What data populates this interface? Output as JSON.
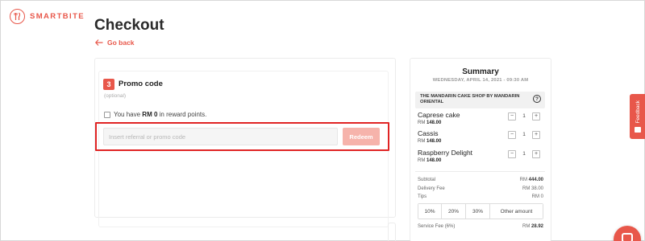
{
  "brand": {
    "name": "SMARTBITE",
    "color": "#e8574a",
    "logo_icon": "fork-knife-icon"
  },
  "page": {
    "title": "Checkout",
    "back_label": "Go back"
  },
  "promo": {
    "step": "3",
    "title": "Promo code",
    "optional": "(optional)",
    "reward_prefix": "You have ",
    "reward_amount": "RM 0",
    "reward_suffix": " in reward points.",
    "reward_checked": false,
    "input_placeholder": "Insert referral or promo code",
    "input_value": "",
    "redeem_label": "Redeem"
  },
  "summary": {
    "title": "Summary",
    "datetime": "WEDNESDAY, APRIL 14, 2021 - 09:30 AM",
    "shop": "THE MANDARIN CAKE SHOP BY MANDARIN ORIENTAL",
    "help": "?",
    "items": [
      {
        "name": "Caprese cake",
        "currency": "RM ",
        "price": "148.00",
        "qty": "1"
      },
      {
        "name": "Cassis",
        "currency": "RM ",
        "price": "148.00",
        "qty": "1"
      },
      {
        "name": "Raspberry Delight",
        "currency": "RM ",
        "price": "148.00",
        "qty": "1"
      }
    ],
    "qty_minus": "−",
    "qty_plus": "+",
    "subtotal_label": "Subtotal",
    "subtotal_currency": "RM ",
    "subtotal_value": "444.00",
    "delivery_label": "Delivery Fee",
    "delivery_value": "RM 38.00",
    "tips_label": "Tips",
    "tips_value": "RM 0",
    "tip_options": [
      "10%",
      "20%",
      "30%",
      "Other amount"
    ],
    "service_label": "Service Fee",
    "service_pct": "(6%)",
    "service_currency": "RM ",
    "service_value": "28.92"
  },
  "feedback": {
    "label": "Feedback"
  }
}
